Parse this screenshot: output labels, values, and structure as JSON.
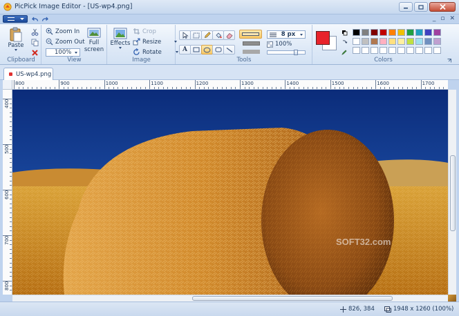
{
  "window": {
    "title": "PicPick Image Editor - [US-wp4.png]"
  },
  "ribbon": {
    "clipboard": {
      "paste_label": "Paste",
      "group_label": "Clipboard"
    },
    "view": {
      "zoom_in_label": "Zoom In",
      "zoom_out_label": "Zoom Out",
      "zoom_value": "100%",
      "full_screen_label_1": "Full",
      "full_screen_label_2": "screen",
      "group_label": "View"
    },
    "image": {
      "effects_label": "Effects",
      "crop_label": "Crop",
      "resize_label": "Resize",
      "rotate_label": "Rotate",
      "group_label": "Image"
    },
    "tools": {
      "line_width": "8 px",
      "opacity": "100%",
      "group_label": "Tools"
    },
    "colors": {
      "primary_color": "#e8232b",
      "secondary_color": "#ffffff",
      "group_label": "Colors",
      "palette_row1": [
        "#000000",
        "#808080",
        "#800000",
        "#c00000",
        "#ff8000",
        "#f0c000",
        "#20a040",
        "#20a0c0",
        "#4040c0",
        "#a040a0"
      ],
      "palette_row2": [
        "#ffffff",
        "#c0c0c0",
        "#b07850",
        "#ffb0c0",
        "#ffe080",
        "#fff0a0",
        "#c0e040",
        "#a0e0f0",
        "#7090c0",
        "#c0a0d0"
      ],
      "palette_row3": [
        "#ffffff",
        "#ffffff",
        "#ffffff",
        "#ffffff",
        "#ffffff",
        "#ffffff",
        "#ffffff",
        "#ffffff",
        "#ffffff",
        "#ffffff"
      ]
    }
  },
  "document": {
    "tab_label": "US-wp4.png"
  },
  "rulers": {
    "top_labels": [
      "800",
      "900",
      "1000",
      "1100",
      "1200",
      "1300",
      "1400",
      "1500",
      "1600",
      "1700"
    ],
    "left_labels": [
      "400",
      "500",
      "600",
      "700",
      "800"
    ]
  },
  "canvas": {
    "watermark": "SOFT32.com"
  },
  "statusbar": {
    "cursor_position": "826, 384",
    "image_info": "1948 x 1260  (100%)"
  }
}
